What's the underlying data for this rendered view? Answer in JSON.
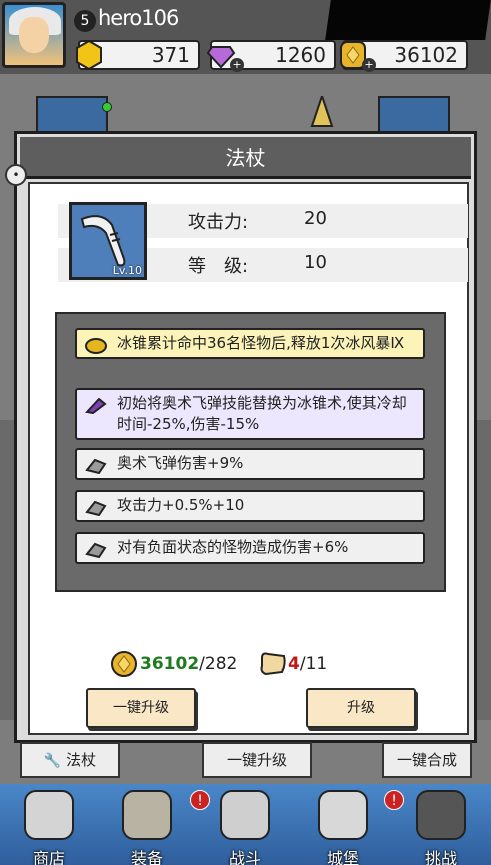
{
  "player": {
    "level": "5",
    "name": "hero106"
  },
  "currencies": [
    {
      "icon": "gold-hexagon-icon",
      "value": "371"
    },
    {
      "icon": "purple-gem-icon",
      "value": "1260"
    },
    {
      "icon": "gold-coin-icon",
      "value": "36102"
    }
  ],
  "dialog": {
    "title": "法杖",
    "item": {
      "level_label": "Lv.10"
    },
    "stats": [
      {
        "label": "攻击力:",
        "value": "20"
      },
      {
        "label": "等　级:",
        "value": "10"
      }
    ],
    "affixes": [
      {
        "tier": "gold",
        "icon": "gold-rune-icon",
        "text": "冰锥累计命中36名怪物后,释放1次冰风暴Ⅸ"
      },
      {
        "tier": "purple",
        "icon": "purple-crystal-icon",
        "text": "初始将奥术飞弹技能替换为冰锥术,使其冷却时间-25%,伤害-15%"
      },
      {
        "tier": "gray",
        "icon": "stone-icon",
        "text": "奥术飞弹伤害+9%"
      },
      {
        "tier": "gray",
        "icon": "stone-icon",
        "text": "攻击力+0.5%+10"
      },
      {
        "tier": "gray",
        "icon": "stone-icon",
        "text": "对有负面状态的怪物造成伤害+6%"
      }
    ],
    "cost": {
      "coins_have": "36102",
      "coins_need": "/282",
      "scrolls_have": "4",
      "scrolls_need": "/11"
    },
    "buttons": {
      "one_click_upgrade": "一键升级",
      "upgrade": "升级"
    }
  },
  "under_bar": {
    "weapon": "法杖",
    "one_click_upgrade": "一键升级",
    "one_click_merge": "一键合成"
  },
  "bottom_nav": [
    {
      "label": "商店",
      "badge": ""
    },
    {
      "label": "装备",
      "badge": "!"
    },
    {
      "label": "战斗",
      "badge": ""
    },
    {
      "label": "城堡",
      "badge": "!"
    },
    {
      "label": "挑战",
      "badge": ""
    }
  ],
  "colors": {
    "gold_affix": "#fbf3b8",
    "purple_affix": "#ece7ff",
    "coins_have": "#1f7a1f",
    "scrolls_have": "#c01818"
  }
}
